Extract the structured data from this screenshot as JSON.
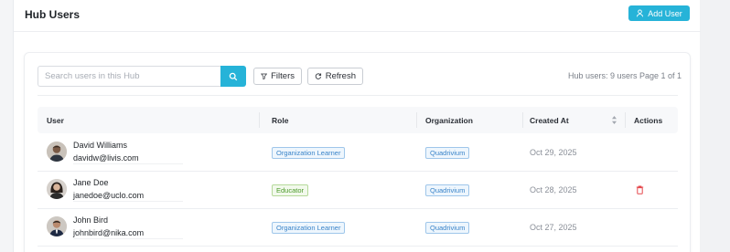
{
  "header": {
    "title": "Hub Users",
    "add_user_label": "Add User"
  },
  "toolbar": {
    "search_placeholder": "Search users in this Hub",
    "filters_label": "Filters",
    "refresh_label": "Refresh",
    "hub_count": "Hub users: 9 users",
    "page_info": "Page 1 of 1"
  },
  "table": {
    "columns": [
      "User",
      "Role",
      "Organization",
      "Created At",
      "Actions"
    ],
    "rows": [
      {
        "name": "David Williams",
        "email": "davidw@livis.com",
        "role": "Organization Learner",
        "role_style": "blue",
        "organization": "Quadrivium",
        "created_at": "Oct 29, 2025",
        "has_delete": false
      },
      {
        "name": "Jane Doe",
        "email": "janedoe@uclo.com",
        "role": "Educator",
        "role_style": "green",
        "organization": "Quadrivium",
        "created_at": "Oct 28, 2025",
        "has_delete": true
      },
      {
        "name": "John Bird",
        "email": "johnbird@nika.com",
        "role": "Organization Learner",
        "role_style": "blue",
        "organization": "Quadrivium",
        "created_at": "Oct 27, 2025",
        "has_delete": false
      }
    ]
  },
  "colors": {
    "accent": "#26b3d8",
    "badge_blue": "#3a84c9",
    "badge_green": "#4c9a2a",
    "delete_red": "#e5484d"
  },
  "icons": {
    "add_user": "user-icon",
    "search": "search-icon",
    "filters": "filter-icon",
    "refresh": "refresh-icon",
    "sort": "sort-icon",
    "delete": "trash-icon"
  }
}
